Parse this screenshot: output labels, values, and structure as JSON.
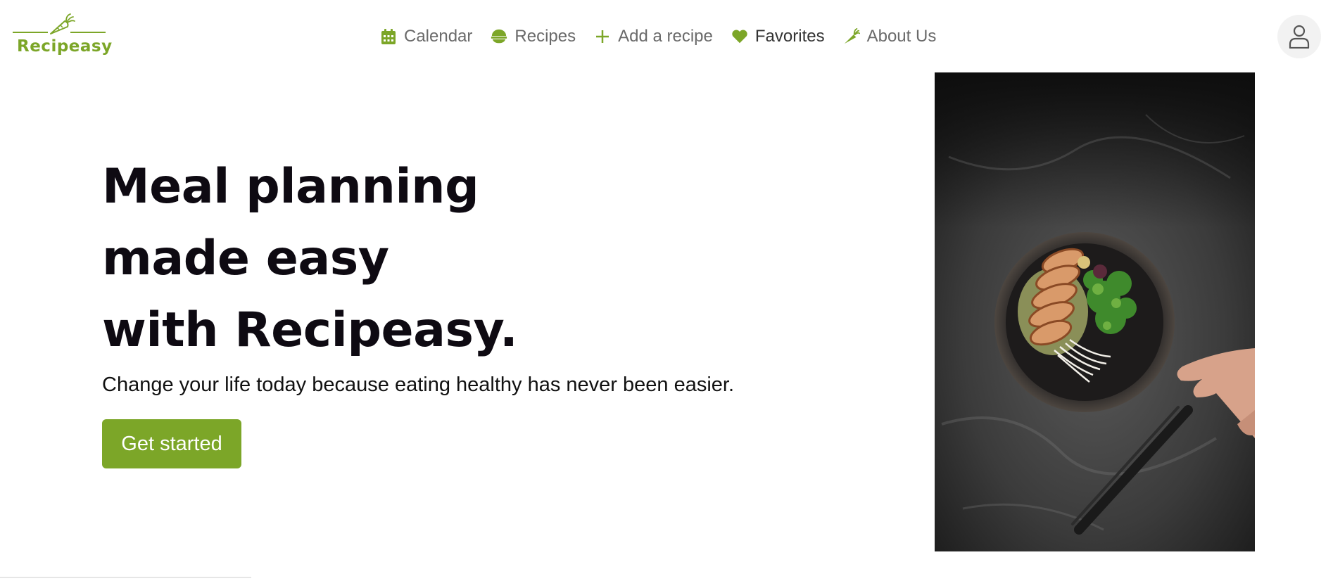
{
  "brand": {
    "name": "Recipeasy",
    "accent_color": "#7ca628",
    "logo_icon": "carrot-icon"
  },
  "nav": {
    "items": [
      {
        "label": "Calendar",
        "icon": "calendar-icon",
        "active": false
      },
      {
        "label": "Recipes",
        "icon": "bowl-icon",
        "active": false
      },
      {
        "label": "Add a recipe",
        "icon": "plus-icon",
        "active": false
      },
      {
        "label": "Favorites",
        "icon": "heart-icon",
        "active": true
      },
      {
        "label": "About Us",
        "icon": "carrot-icon",
        "active": false
      }
    ]
  },
  "user": {
    "icon": "user-icon"
  },
  "hero": {
    "title_lines": [
      "Meal planning",
      "made easy",
      "with Recipeasy."
    ],
    "subtitle": "Change your life today because eating healthy has never been easier.",
    "cta_label": "Get started",
    "image_subject": "bowl-of-food-photo"
  }
}
